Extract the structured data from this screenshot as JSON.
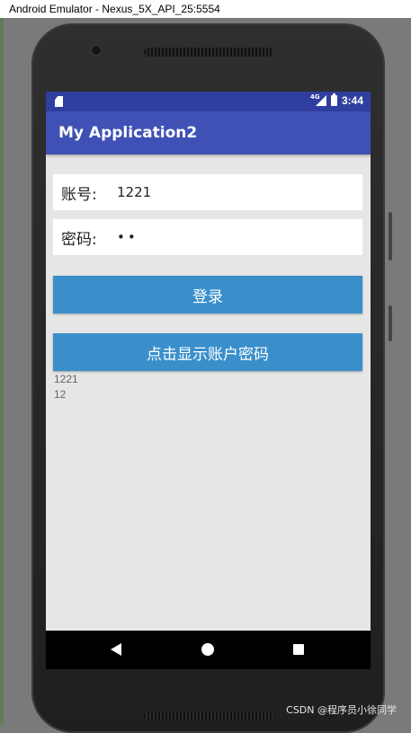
{
  "window": {
    "title": "Android Emulator - Nexus_5X_API_25:5554"
  },
  "status_bar": {
    "network": "4G",
    "time": "3:44"
  },
  "app": {
    "title": "My Application2"
  },
  "form": {
    "account_label": "账号:",
    "account_value": "1221",
    "password_label": "密码:",
    "password_value": "••"
  },
  "buttons": {
    "login_label": "登录",
    "show_label": "点击显示账户密码"
  },
  "output": {
    "line1": "1221",
    "line2": "12"
  },
  "watermark": "CSDN @程序员小徐同学",
  "colors": {
    "status_bar": "#303f9f",
    "app_bar": "#3f51b5",
    "button": "#3a8fcb"
  }
}
